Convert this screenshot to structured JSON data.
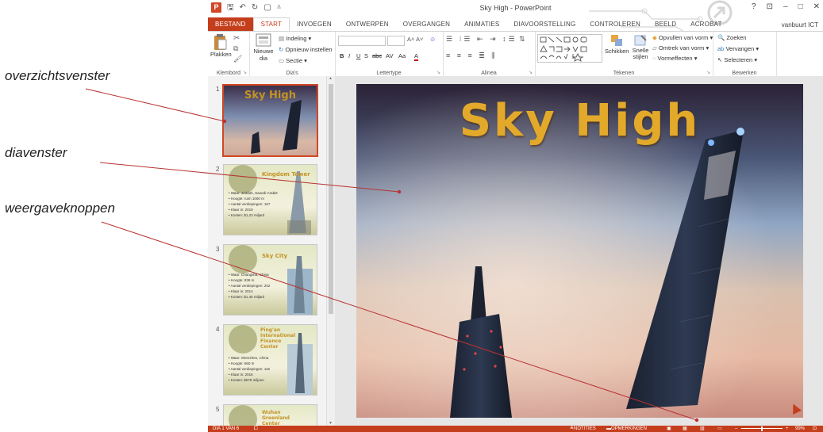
{
  "callouts": {
    "overview": "overzichtsvenster",
    "slide": "diavenster",
    "view": "weergaveknoppen"
  },
  "app": {
    "window_title": "Sky High - PowerPoint",
    "account": "vanbuurt ICT",
    "tabs": [
      "BESTAND",
      "START",
      "INVOEGEN",
      "ONTWERPEN",
      "OVERGANGEN",
      "ANIMATIES",
      "DIAVOORSTELLING",
      "CONTROLEREN",
      "BEELD",
      "ACROBAT"
    ],
    "active_tab": "START",
    "win_buttons": [
      "?",
      "⊡",
      "–",
      "□",
      "✕"
    ]
  },
  "ribbon": {
    "clipboard": {
      "paste": "Plakken",
      "label": "Klembord"
    },
    "slides": {
      "new_slide": "Nieuwe dia",
      "layout": "Indeling",
      "reset": "Opnieuw instellen",
      "section": "Sectie",
      "label": "Dia's"
    },
    "font": {
      "label": "Lettertype",
      "bold": "B",
      "italic": "I",
      "underline": "U",
      "shadow": "S",
      "strike": "abc",
      "spacing": "AV",
      "case": "Aa",
      "color": "A"
    },
    "paragraph": {
      "label": "Alinea"
    },
    "drawing": {
      "arrange": "Schikken",
      "quick_styles": "Snelle stijlen",
      "fill": "Opvullen van vorm",
      "outline": "Omtrek van vorm",
      "effects": "Vormeffecten",
      "label": "Tekenen"
    },
    "editing": {
      "find": "Zoeken",
      "replace": "Vervangen",
      "select": "Selecteren",
      "label": "Bewerken"
    }
  },
  "slides": [
    {
      "number": "1",
      "title": "Sky High"
    },
    {
      "number": "2",
      "title": "Kingdom Tower",
      "bullets": [
        "Waar: Jeddah, Saoedi-Arabië",
        "Hoogte: ruim 1000 m",
        "Aantal verdiepingen: 167",
        "Klaar in: 2019",
        "Kosten: $1,23 miljard"
      ]
    },
    {
      "number": "3",
      "title": "Sky City",
      "bullets": [
        "Waar: Changsha, China",
        "Hoogte: 838 m",
        "Aantal verdiepingen: 202",
        "Klaar in: 2014",
        "Kosten: $1,46 miljard"
      ]
    },
    {
      "number": "4",
      "title": "Ping'an International Finance Center",
      "bullets": [
        "Waar: Shenzhen, China",
        "Hoogte: 660 m",
        "Aantal verdiepingen: 115",
        "Klaar in: 2016",
        "Kosten: $678 miljoen"
      ]
    },
    {
      "number": "5",
      "title": "Wuhan Greenland Center"
    }
  ],
  "main_slide": {
    "title": "Sky High"
  },
  "status": {
    "slide_info": "DIA 1 VAN 6",
    "notes": "NOTITIES",
    "comments": "OPMERKINGEN",
    "zoom": "99%"
  }
}
